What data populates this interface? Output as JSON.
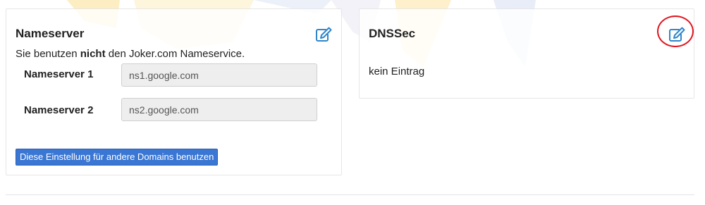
{
  "nameserver_panel": {
    "title": "Nameserver",
    "info_prefix": "Sie benutzen ",
    "info_bold": "nicht",
    "info_suffix": " den Joker.com Nameservice.",
    "rows": [
      {
        "label": "Nameserver 1",
        "value": "ns1.google.com"
      },
      {
        "label": "Nameserver 2",
        "value": "ns2.google.com"
      }
    ],
    "apply_button_label": "Diese Einstellung für andere Domains benutzen",
    "edit_icon": "edit-icon"
  },
  "dnssec_panel": {
    "title": "DNSSec",
    "empty_text": "kein Eintrag",
    "edit_icon": "edit-icon",
    "highlight_color": "#e0141e"
  },
  "colors": {
    "accent": "#2e86c9",
    "button_bg": "#3a76d3"
  }
}
